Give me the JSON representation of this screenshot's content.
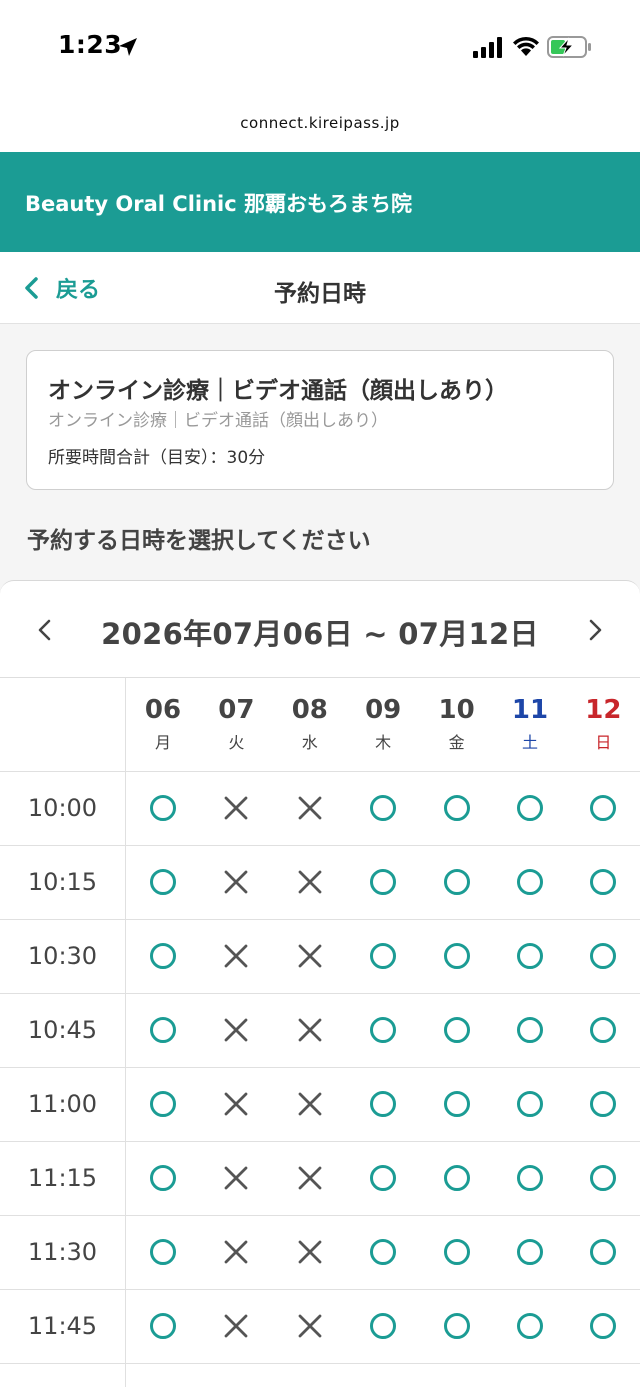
{
  "status_bar": {
    "time": "1:23"
  },
  "browser": {
    "url": "connect.kireipass.jp"
  },
  "header": {
    "clinic_name": "Beauty Oral Clinic 那覇おもろまち院"
  },
  "nav": {
    "back_label": "戻る",
    "title": "予約日時"
  },
  "menu": {
    "title": "オンライン診療｜ビデオ通話（顔出しあり）",
    "subtitle": "オンライン診療｜ビデオ通話（顔出しあり）",
    "duration": "所要時間合計（目安）：30分"
  },
  "prompt": "予約する日時を選択してください",
  "calendar": {
    "week_range": "2026年07月06日 ~ 07月12日",
    "days": [
      {
        "num": "06",
        "weekday": "月",
        "kind": "weekday"
      },
      {
        "num": "07",
        "weekday": "火",
        "kind": "weekday"
      },
      {
        "num": "08",
        "weekday": "水",
        "kind": "weekday"
      },
      {
        "num": "09",
        "weekday": "木",
        "kind": "weekday"
      },
      {
        "num": "10",
        "weekday": "金",
        "kind": "weekday"
      },
      {
        "num": "11",
        "weekday": "土",
        "kind": "saturday"
      },
      {
        "num": "12",
        "weekday": "日",
        "kind": "sunday"
      }
    ],
    "slots": [
      {
        "time": "10:00",
        "availability": [
          "open",
          "full",
          "full",
          "open",
          "open",
          "open",
          "open"
        ]
      },
      {
        "time": "10:15",
        "availability": [
          "open",
          "full",
          "full",
          "open",
          "open",
          "open",
          "open"
        ]
      },
      {
        "time": "10:30",
        "availability": [
          "open",
          "full",
          "full",
          "open",
          "open",
          "open",
          "open"
        ]
      },
      {
        "time": "10:45",
        "availability": [
          "open",
          "full",
          "full",
          "open",
          "open",
          "open",
          "open"
        ]
      },
      {
        "time": "11:00",
        "availability": [
          "open",
          "full",
          "full",
          "open",
          "open",
          "open",
          "open"
        ]
      },
      {
        "time": "11:15",
        "availability": [
          "open",
          "full",
          "full",
          "open",
          "open",
          "open",
          "open"
        ]
      },
      {
        "time": "11:30",
        "availability": [
          "open",
          "full",
          "full",
          "open",
          "open",
          "open",
          "open"
        ]
      },
      {
        "time": "11:45",
        "availability": [
          "open",
          "full",
          "full",
          "open",
          "open",
          "open",
          "open"
        ]
      }
    ]
  },
  "colors": {
    "accent": "#1b9c94",
    "saturday": "#1d46a8",
    "sunday": "#c8262b",
    "unavailable": "#555555"
  }
}
